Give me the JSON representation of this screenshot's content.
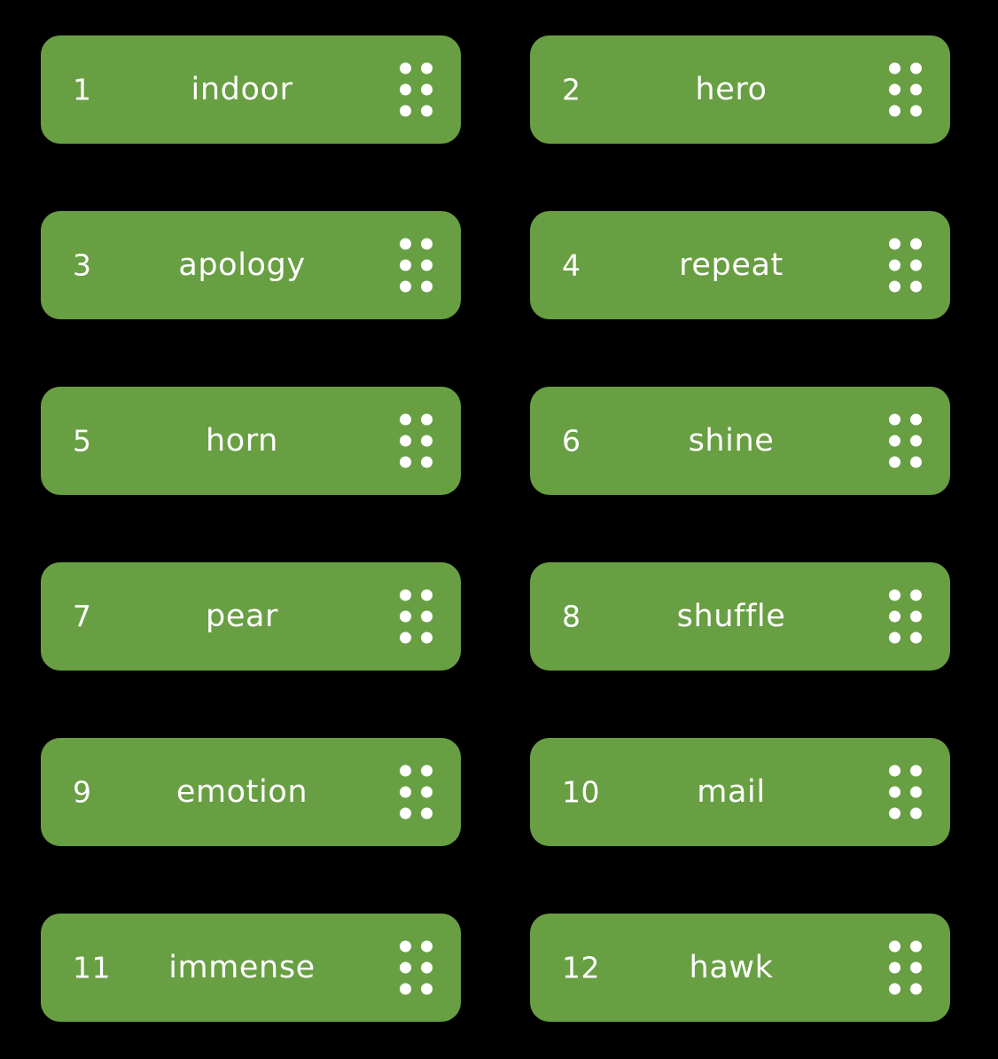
{
  "page": {
    "background_color": "#000000",
    "layout": "two-column-grid",
    "columns": 2,
    "total_cards": 12
  },
  "card_style": {
    "fill_color": "#689f43",
    "text_color": "#ffffff",
    "handle_icon": "drag-handle-icon",
    "handle_dot_count": 6
  },
  "cards": [
    {
      "index": "1",
      "word": "indoor"
    },
    {
      "index": "2",
      "word": "hero"
    },
    {
      "index": "3",
      "word": "apology"
    },
    {
      "index": "4",
      "word": "repeat"
    },
    {
      "index": "5",
      "word": "horn"
    },
    {
      "index": "6",
      "word": "shine"
    },
    {
      "index": "7",
      "word": "pear"
    },
    {
      "index": "8",
      "word": "shuffle"
    },
    {
      "index": "9",
      "word": "emotion"
    },
    {
      "index": "10",
      "word": "mail"
    },
    {
      "index": "11",
      "word": "immense"
    },
    {
      "index": "12",
      "word": "hawk"
    }
  ]
}
